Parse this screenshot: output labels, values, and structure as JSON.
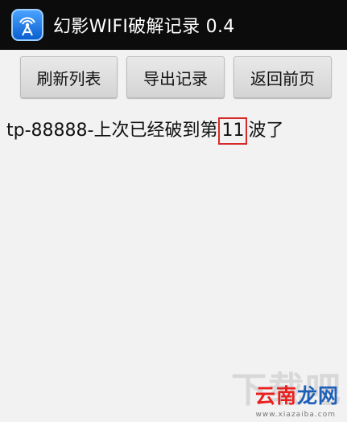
{
  "titlebar": {
    "icon": "wifi-tower-icon",
    "title": "幻影WIFI破解记录 0.4"
  },
  "toolbar": {
    "refresh_label": "刷新列表",
    "export_label": "导出记录",
    "back_label": "返回前页"
  },
  "records": [
    {
      "prefix": "tp-88888-上次已经破到第",
      "number": "11",
      "suffix": "波了"
    }
  ],
  "colors": {
    "titlebar_bg": "#0c0c0c",
    "highlight_border": "#d62a2a",
    "watermark_red": "#e9201f",
    "watermark_blue": "#1d5fb8"
  },
  "watermark": {
    "ghost": "下载吧",
    "part_a": "云南",
    "part_b": "龙网",
    "url": "www.xiazaiba.com"
  }
}
